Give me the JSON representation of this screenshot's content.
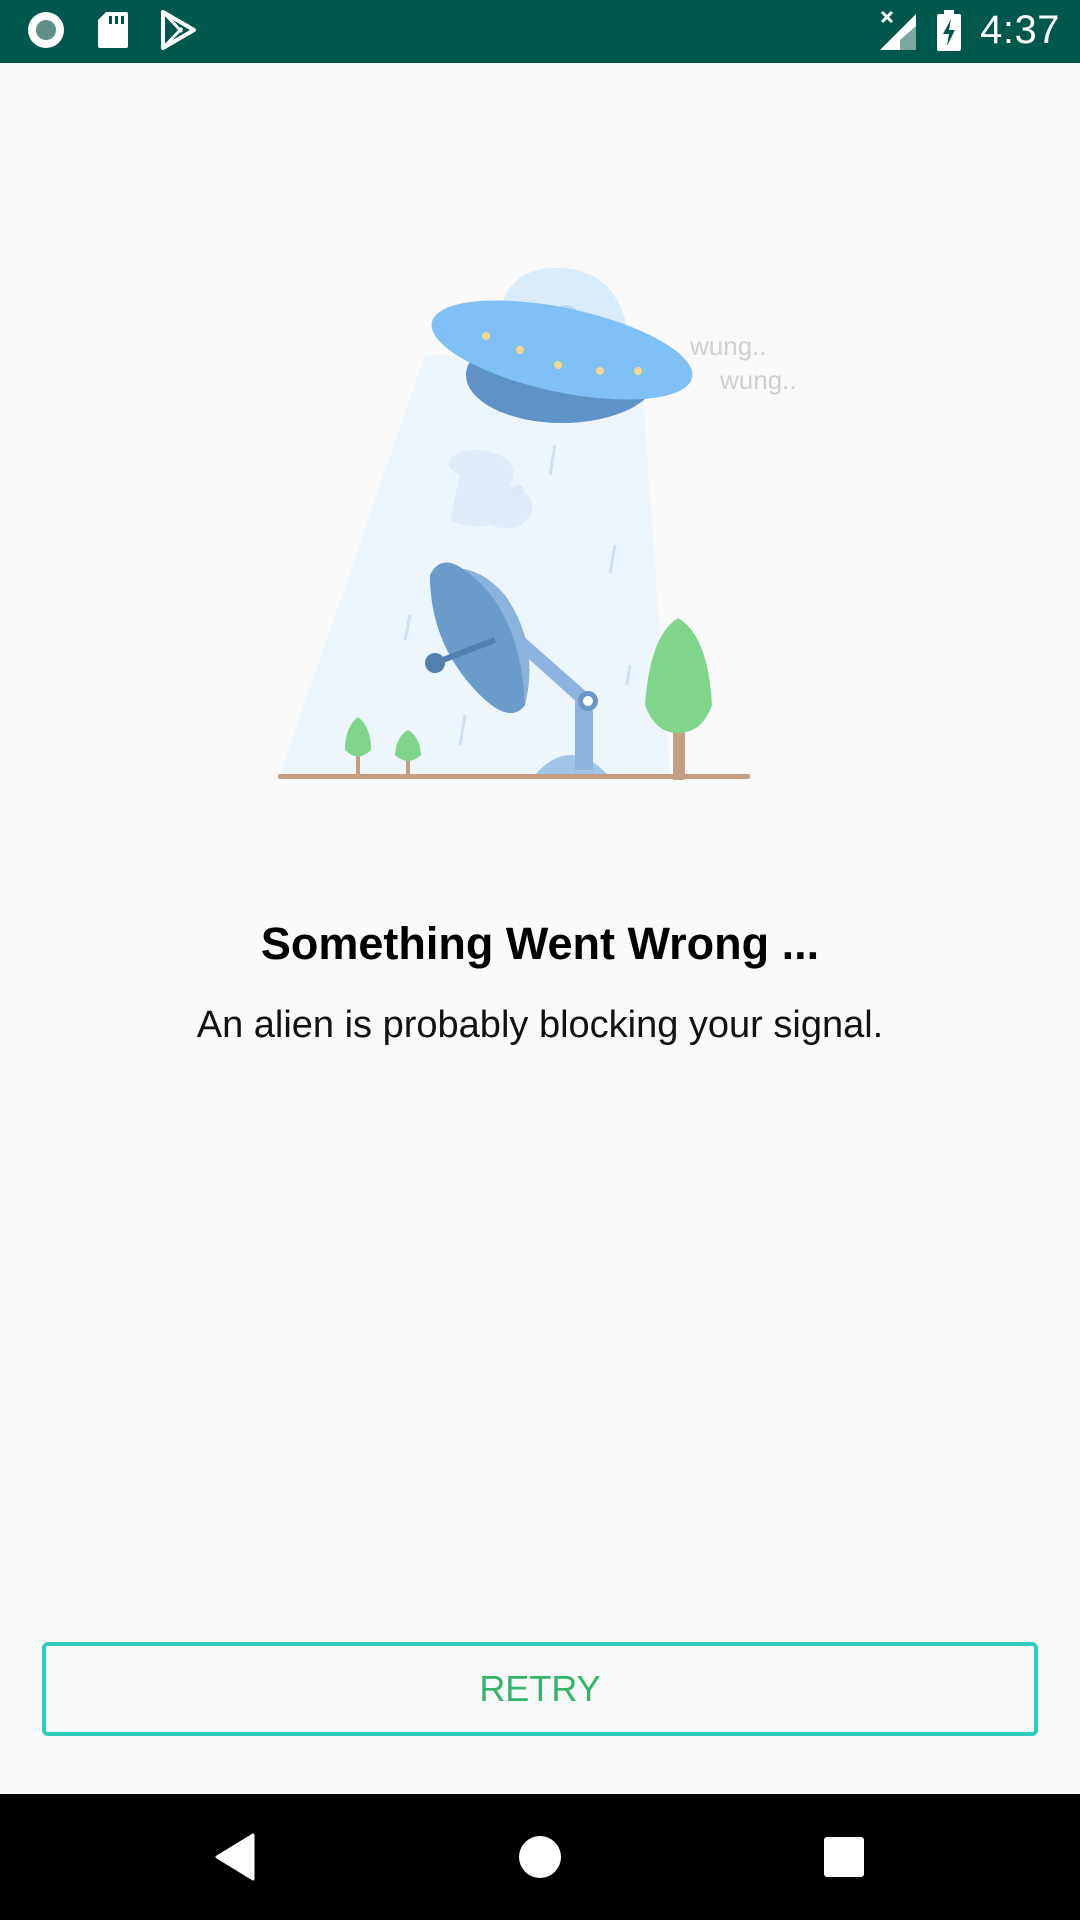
{
  "status_bar": {
    "time": "4:37",
    "icons": [
      "record-icon",
      "sd-card-icon",
      "play-store-icon",
      "no-signal-icon",
      "battery-charging-icon"
    ]
  },
  "illustration": {
    "name": "ufo-satellite-dish-icon",
    "caption_line1": "wung..",
    "caption_line2": "wung.."
  },
  "error": {
    "title": "Something Went Wrong ...",
    "message": "An alien is probably blocking your signal."
  },
  "actions": {
    "retry_label": "RETRY"
  },
  "colors": {
    "status_bar": "#00574b",
    "retry_border": "#2ecdb9",
    "retry_text": "#33b46a",
    "background": "#fafafa"
  },
  "nav_bar": {
    "icons": [
      "back-icon",
      "home-icon",
      "recents-icon"
    ]
  }
}
